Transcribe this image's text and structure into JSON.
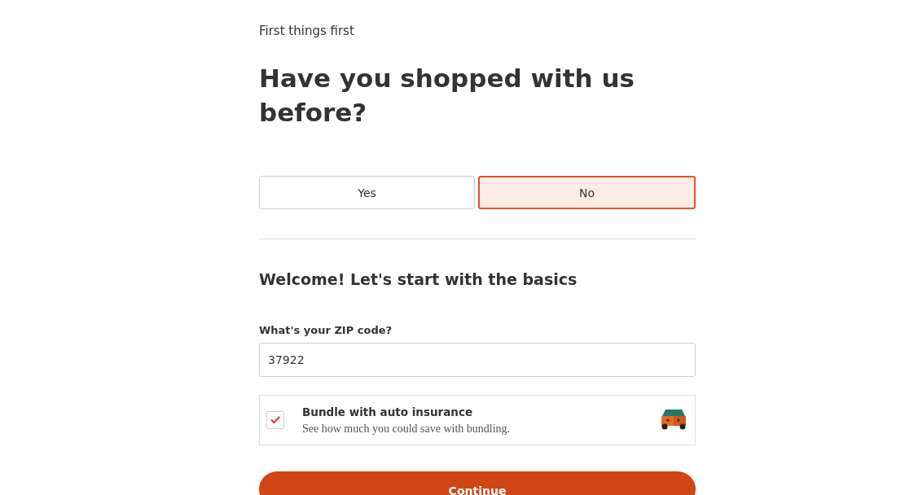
{
  "eyebrow": "First things first",
  "heading": "Have you shopped with us before?",
  "choices": [
    {
      "label": "Yes",
      "selected": false
    },
    {
      "label": "No",
      "selected": true
    }
  ],
  "section_title": "Welcome! Let's start with the basics",
  "zip": {
    "label": "What's your ZIP code?",
    "value": "37922"
  },
  "bundle": {
    "checked": true,
    "title": "Bundle with auto insurance",
    "description": "See how much you could save with bundling."
  },
  "continue_button": "Continue"
}
